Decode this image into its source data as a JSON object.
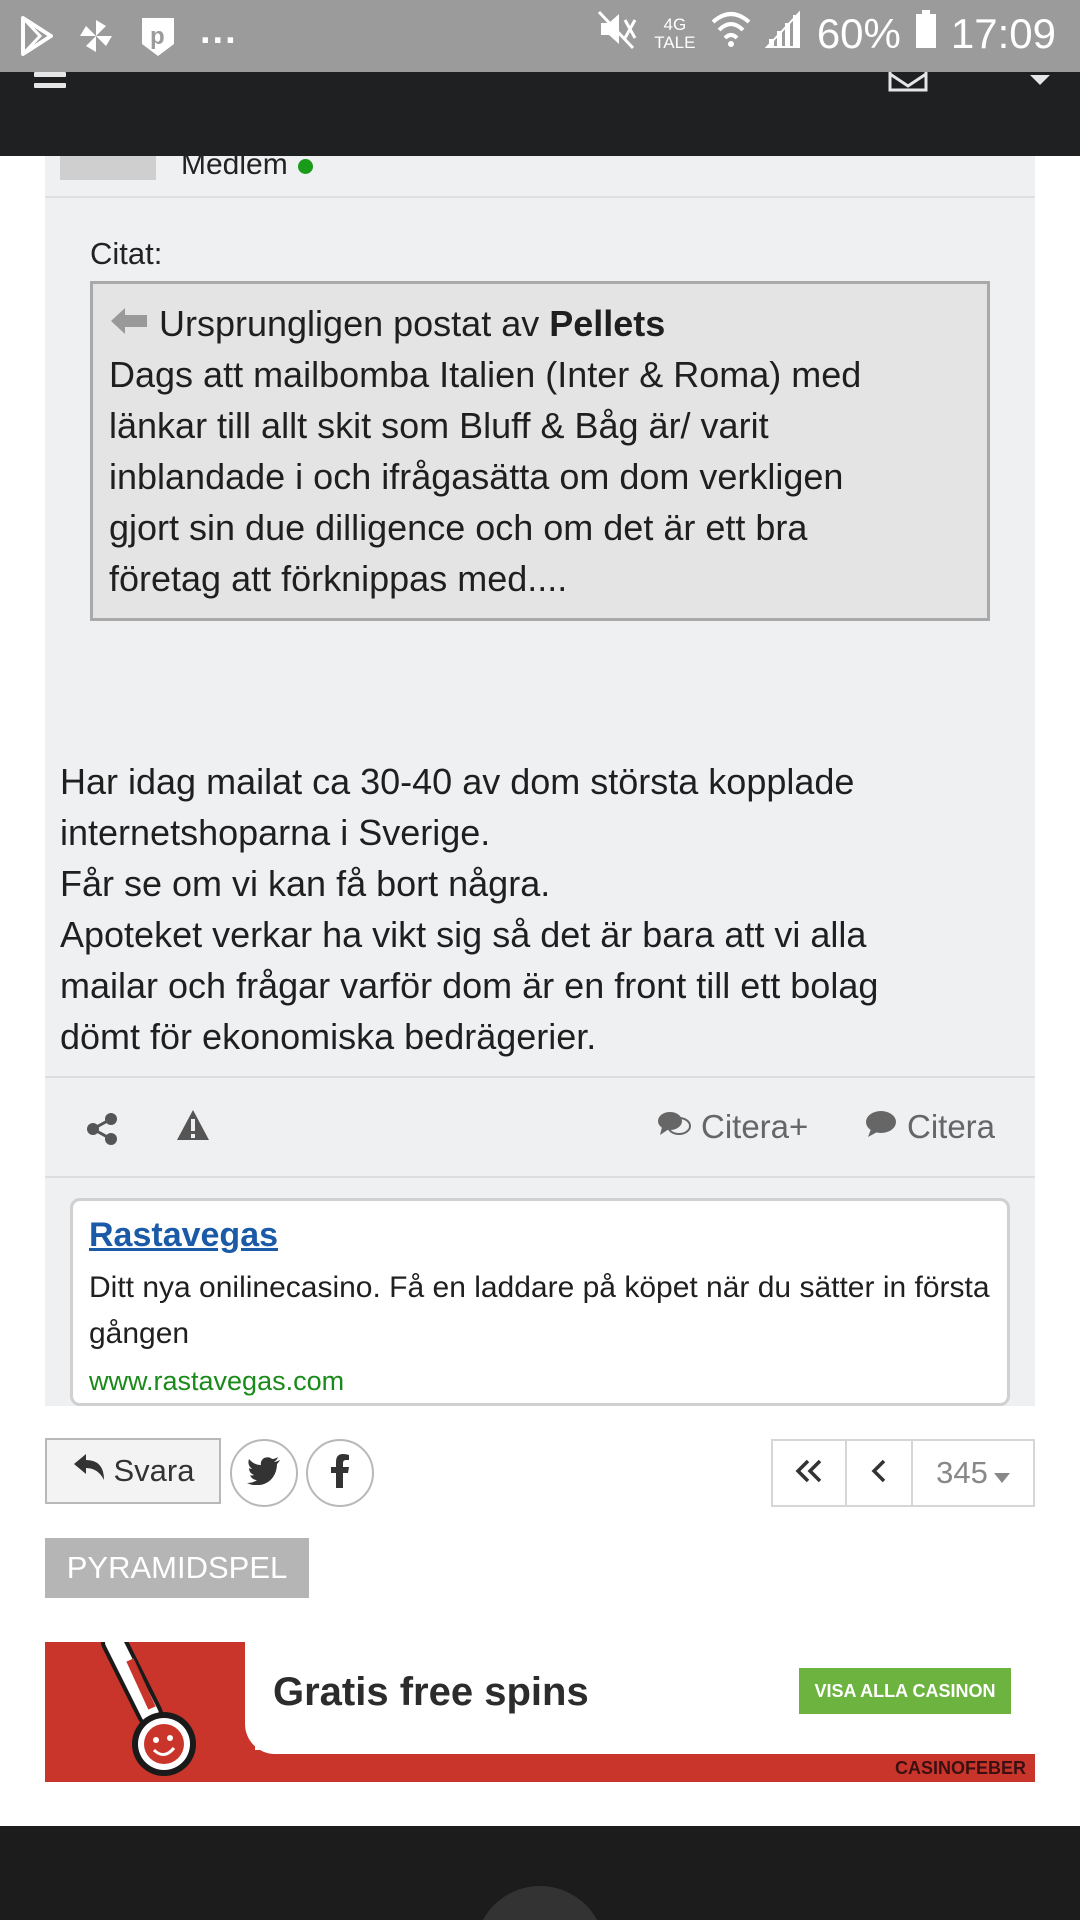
{
  "status_bar": {
    "network_type": "4G",
    "network_sub": "TALE",
    "battery": "60%",
    "time": "17:09",
    "overflow": "..."
  },
  "post": {
    "member_label": "Medlem",
    "quote_label": "Citat:",
    "quote_prefix": "Ursprungligen postat av",
    "quote_author": "Pellets",
    "quote_lines": [
      "Dags att mailbomba Italien (Inter & Roma) med",
      "länkar till allt skit som Bluff & Båg är/ varit",
      "inblandade i och ifrågasätta om dom verkligen",
      "gjort sin due dilligence och om det är ett bra",
      "företag att förknippas med...."
    ],
    "body_lines": [
      "Har idag mailat ca 30-40 av dom största kopplade",
      "internetshoparna i Sverige.",
      "Får se om vi kan få bort några.",
      "Apoteket verkar ha vikt sig så det är bara att vi alla",
      "mailar och frågar varför dom är en front till ett bolag",
      "dömt för ekonomiska bedrägerier."
    ],
    "actions": {
      "citera_plus": "Citera+",
      "citera": "Citera"
    }
  },
  "ad": {
    "title": "Rastavegas",
    "description": "Ditt nya onilinecasino. Få en laddare på köpet när du sätter in första gången",
    "url": "www.rastavegas.com"
  },
  "controls": {
    "reply_label": "Svara",
    "page_number": "345"
  },
  "tag": "PYRAMIDSPEL",
  "banner": {
    "title": "Gratis free spins",
    "cta": "VISA ALLA CASINON",
    "brand": "CASINOFEBER"
  },
  "colors": {
    "accent_link": "#1a5aa6",
    "online": "#1a9c1a",
    "cta_green": "#6cb33f",
    "banner_red": "#c9352b"
  }
}
